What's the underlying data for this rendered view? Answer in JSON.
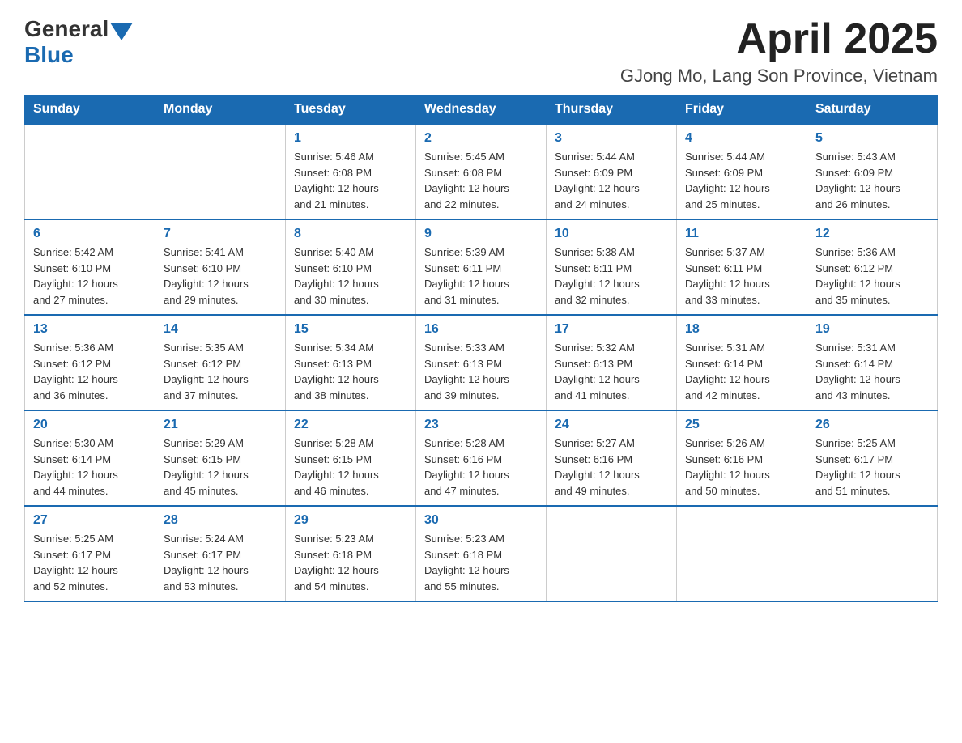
{
  "header": {
    "title": "April 2025",
    "subtitle": "GJong Mo, Lang Son Province, Vietnam"
  },
  "logo": {
    "general": "General",
    "blue": "Blue"
  },
  "days_of_week": [
    "Sunday",
    "Monday",
    "Tuesday",
    "Wednesday",
    "Thursday",
    "Friday",
    "Saturday"
  ],
  "weeks": [
    [
      {
        "number": "",
        "info": ""
      },
      {
        "number": "",
        "info": ""
      },
      {
        "number": "1",
        "info": "Sunrise: 5:46 AM\nSunset: 6:08 PM\nDaylight: 12 hours\nand 21 minutes."
      },
      {
        "number": "2",
        "info": "Sunrise: 5:45 AM\nSunset: 6:08 PM\nDaylight: 12 hours\nand 22 minutes."
      },
      {
        "number": "3",
        "info": "Sunrise: 5:44 AM\nSunset: 6:09 PM\nDaylight: 12 hours\nand 24 minutes."
      },
      {
        "number": "4",
        "info": "Sunrise: 5:44 AM\nSunset: 6:09 PM\nDaylight: 12 hours\nand 25 minutes."
      },
      {
        "number": "5",
        "info": "Sunrise: 5:43 AM\nSunset: 6:09 PM\nDaylight: 12 hours\nand 26 minutes."
      }
    ],
    [
      {
        "number": "6",
        "info": "Sunrise: 5:42 AM\nSunset: 6:10 PM\nDaylight: 12 hours\nand 27 minutes."
      },
      {
        "number": "7",
        "info": "Sunrise: 5:41 AM\nSunset: 6:10 PM\nDaylight: 12 hours\nand 29 minutes."
      },
      {
        "number": "8",
        "info": "Sunrise: 5:40 AM\nSunset: 6:10 PM\nDaylight: 12 hours\nand 30 minutes."
      },
      {
        "number": "9",
        "info": "Sunrise: 5:39 AM\nSunset: 6:11 PM\nDaylight: 12 hours\nand 31 minutes."
      },
      {
        "number": "10",
        "info": "Sunrise: 5:38 AM\nSunset: 6:11 PM\nDaylight: 12 hours\nand 32 minutes."
      },
      {
        "number": "11",
        "info": "Sunrise: 5:37 AM\nSunset: 6:11 PM\nDaylight: 12 hours\nand 33 minutes."
      },
      {
        "number": "12",
        "info": "Sunrise: 5:36 AM\nSunset: 6:12 PM\nDaylight: 12 hours\nand 35 minutes."
      }
    ],
    [
      {
        "number": "13",
        "info": "Sunrise: 5:36 AM\nSunset: 6:12 PM\nDaylight: 12 hours\nand 36 minutes."
      },
      {
        "number": "14",
        "info": "Sunrise: 5:35 AM\nSunset: 6:12 PM\nDaylight: 12 hours\nand 37 minutes."
      },
      {
        "number": "15",
        "info": "Sunrise: 5:34 AM\nSunset: 6:13 PM\nDaylight: 12 hours\nand 38 minutes."
      },
      {
        "number": "16",
        "info": "Sunrise: 5:33 AM\nSunset: 6:13 PM\nDaylight: 12 hours\nand 39 minutes."
      },
      {
        "number": "17",
        "info": "Sunrise: 5:32 AM\nSunset: 6:13 PM\nDaylight: 12 hours\nand 41 minutes."
      },
      {
        "number": "18",
        "info": "Sunrise: 5:31 AM\nSunset: 6:14 PM\nDaylight: 12 hours\nand 42 minutes."
      },
      {
        "number": "19",
        "info": "Sunrise: 5:31 AM\nSunset: 6:14 PM\nDaylight: 12 hours\nand 43 minutes."
      }
    ],
    [
      {
        "number": "20",
        "info": "Sunrise: 5:30 AM\nSunset: 6:14 PM\nDaylight: 12 hours\nand 44 minutes."
      },
      {
        "number": "21",
        "info": "Sunrise: 5:29 AM\nSunset: 6:15 PM\nDaylight: 12 hours\nand 45 minutes."
      },
      {
        "number": "22",
        "info": "Sunrise: 5:28 AM\nSunset: 6:15 PM\nDaylight: 12 hours\nand 46 minutes."
      },
      {
        "number": "23",
        "info": "Sunrise: 5:28 AM\nSunset: 6:16 PM\nDaylight: 12 hours\nand 47 minutes."
      },
      {
        "number": "24",
        "info": "Sunrise: 5:27 AM\nSunset: 6:16 PM\nDaylight: 12 hours\nand 49 minutes."
      },
      {
        "number": "25",
        "info": "Sunrise: 5:26 AM\nSunset: 6:16 PM\nDaylight: 12 hours\nand 50 minutes."
      },
      {
        "number": "26",
        "info": "Sunrise: 5:25 AM\nSunset: 6:17 PM\nDaylight: 12 hours\nand 51 minutes."
      }
    ],
    [
      {
        "number": "27",
        "info": "Sunrise: 5:25 AM\nSunset: 6:17 PM\nDaylight: 12 hours\nand 52 minutes."
      },
      {
        "number": "28",
        "info": "Sunrise: 5:24 AM\nSunset: 6:17 PM\nDaylight: 12 hours\nand 53 minutes."
      },
      {
        "number": "29",
        "info": "Sunrise: 5:23 AM\nSunset: 6:18 PM\nDaylight: 12 hours\nand 54 minutes."
      },
      {
        "number": "30",
        "info": "Sunrise: 5:23 AM\nSunset: 6:18 PM\nDaylight: 12 hours\nand 55 minutes."
      },
      {
        "number": "",
        "info": ""
      },
      {
        "number": "",
        "info": ""
      },
      {
        "number": "",
        "info": ""
      }
    ]
  ]
}
